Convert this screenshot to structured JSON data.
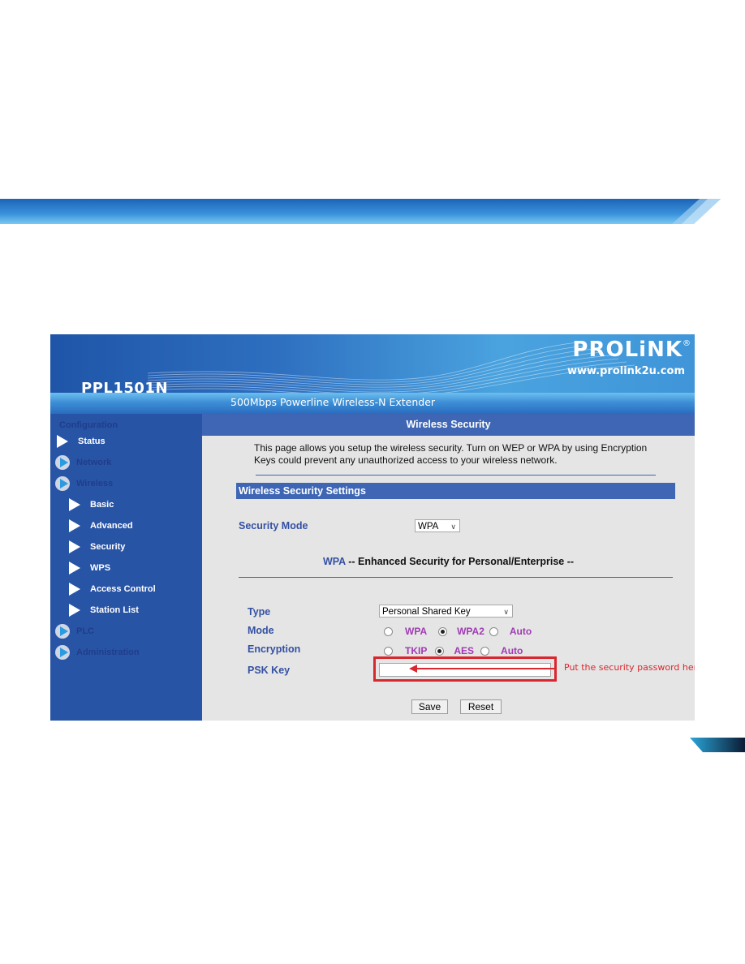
{
  "header": {
    "model": "PPL1501N",
    "tagline": "500Mbps Powerline Wireless-N Extender",
    "brand": "PROLiNK",
    "brand_mark": "®",
    "url": "www.prolink2u.com"
  },
  "sidebar": {
    "section": "Configuration",
    "items": [
      {
        "label": "Status",
        "icon": "triangle-arrow-icon",
        "level": 0,
        "dim": false
      },
      {
        "label": "Network",
        "icon": "circle-arrow-icon",
        "level": 0,
        "dim": true
      },
      {
        "label": "Wireless",
        "icon": "circle-arrow-icon",
        "level": 0,
        "dim": true
      },
      {
        "label": "Basic",
        "icon": "triangle-arrow-icon",
        "level": 1,
        "dim": false
      },
      {
        "label": "Advanced",
        "icon": "triangle-arrow-icon",
        "level": 1,
        "dim": false
      },
      {
        "label": "Security",
        "icon": "triangle-arrow-icon",
        "level": 1,
        "dim": false
      },
      {
        "label": "WPS",
        "icon": "triangle-arrow-icon",
        "level": 1,
        "dim": false
      },
      {
        "label": "Access Control",
        "icon": "triangle-arrow-icon",
        "level": 1,
        "dim": false
      },
      {
        "label": "Station List",
        "icon": "triangle-arrow-icon",
        "level": 1,
        "dim": false
      },
      {
        "label": "PLC",
        "icon": "circle-arrow-icon",
        "level": 0,
        "dim": true
      },
      {
        "label": "Administration",
        "icon": "circle-arrow-icon",
        "level": 0,
        "dim": true
      }
    ]
  },
  "main": {
    "title": "Wireless Security",
    "description": "This page allows you setup the wireless security. Turn on WEP or WPA by using Encryption Keys could prevent any unauthorized access to your wireless network.",
    "section_title": "Wireless Security Settings",
    "security_mode": {
      "label": "Security Mode",
      "value": "WPA"
    },
    "subheading": {
      "prefix": "WPA",
      "text": " -- Enhanced Security for Personal/Enterprise --"
    },
    "type": {
      "label": "Type",
      "value": "Personal Shared Key"
    },
    "mode": {
      "label": "Mode",
      "options": [
        "WPA",
        "WPA2",
        "Auto"
      ],
      "selected": "WPA2"
    },
    "encryption": {
      "label": "Encryption",
      "options": [
        "TKIP",
        "AES",
        "Auto"
      ],
      "selected": "AES"
    },
    "psk_key": {
      "label": "PSK Key",
      "value": ""
    },
    "annotation": "Put the security password here",
    "buttons": {
      "save": "Save",
      "reset": "Reset"
    }
  },
  "colors": {
    "sidebar_bg": "#2854a6",
    "title_bar": "#3e66b5",
    "label_blue": "#3450a3",
    "option_purple": "#a03bb4",
    "annotation_red": "#d9272e"
  }
}
